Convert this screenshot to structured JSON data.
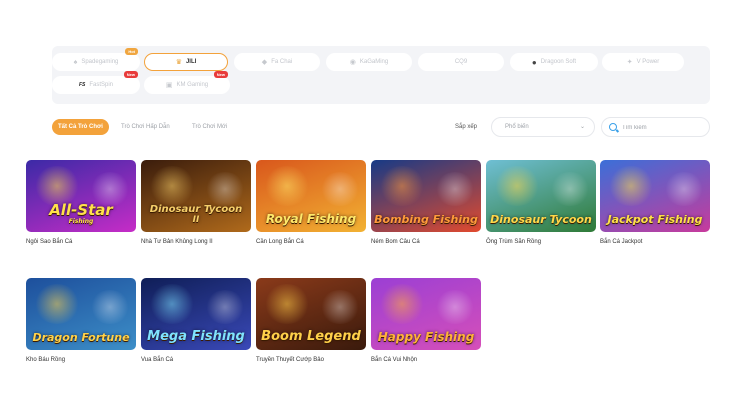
{
  "providers": [
    {
      "name": "Spadegaming",
      "badge": "Hot",
      "active": false
    },
    {
      "name": "JILI",
      "badge": "",
      "active": true
    },
    {
      "name": "Fa Chai",
      "badge": "",
      "active": false
    },
    {
      "name": "KaGaMing",
      "badge": "",
      "active": false
    },
    {
      "name": "CQ9",
      "badge": "",
      "active": false
    },
    {
      "name": "Dragoon Soft",
      "badge": "",
      "active": false
    },
    {
      "name": "V Power",
      "badge": "",
      "active": false
    },
    {
      "name": "FastSpin",
      "badge": "New",
      "active": false
    },
    {
      "name": "KM Gaming",
      "badge": "New",
      "active": false
    }
  ],
  "filters": {
    "tabs": [
      "Tất Cả Trò Chơi",
      "Trò Chơi Hấp Dẫn",
      "Trò Chơi Mới"
    ],
    "active_tab": 0,
    "sort_label": "Sắp xếp",
    "sort_value": "Phổ biến",
    "search_placeholder": "Tìm kiếm"
  },
  "games": [
    {
      "name": "Ngôi Sao Bắn Cá",
      "logo": "All-Star",
      "logo_sub": "Fishing",
      "bg_top": "#3b2aa6",
      "bg_bottom": "#c62cc7",
      "logo_color": "#ffe14a"
    },
    {
      "name": "Nhà Tư Bản Khủng Long II",
      "logo": "Dinosaur Tycoon",
      "logo_sub": "II",
      "bg_top": "#3a1c0c",
      "bg_bottom": "#b06a1b",
      "logo_color": "#f6cf6a"
    },
    {
      "name": "Cần Long Bắn Cá",
      "logo": "Royal Fishing",
      "logo_sub": "",
      "bg_top": "#d9571c",
      "bg_bottom": "#f2b233",
      "logo_color": "#ffe86a"
    },
    {
      "name": "Ném Bom Câu Cá",
      "logo": "Bombing Fishing",
      "logo_sub": "",
      "bg_top": "#173a86",
      "bg_bottom": "#e24a2e",
      "logo_color": "#ff9a3b"
    },
    {
      "name": "Ông Trùm Săn Rồng",
      "logo": "Dinosaur Tycoon",
      "logo_sub": "",
      "bg_top": "#6fbfd4",
      "bg_bottom": "#2f7a36",
      "logo_color": "#ffd84a"
    },
    {
      "name": "Bắn Cá Jackpot",
      "logo": "Jackpot Fishing",
      "logo_sub": "",
      "bg_top": "#3b6fd8",
      "bg_bottom": "#c83a9c",
      "logo_color": "#ffe04a"
    },
    {
      "name": "Kho Báu Rồng",
      "logo": "Dragon Fortune",
      "logo_sub": "",
      "bg_top": "#1d4f9c",
      "bg_bottom": "#3d8fc8",
      "logo_color": "#ffd24a"
    },
    {
      "name": "Vua Bắn Cá",
      "logo": "Mega Fishing",
      "logo_sub": "",
      "bg_top": "#0f1e57",
      "bg_bottom": "#3a49b8",
      "logo_color": "#7fe3ff"
    },
    {
      "name": "Truyền Thuyết Cướp Bảo",
      "logo": "Boom Legend",
      "logo_sub": "",
      "bg_top": "#8a3a1a",
      "bg_bottom": "#3a1a0c",
      "logo_color": "#ffd04a"
    },
    {
      "name": "Bắn Cá Vui Nhộn",
      "logo": "Happy Fishing",
      "logo_sub": "",
      "bg_top": "#9b3fd4",
      "bg_bottom": "#d64fb9",
      "logo_color": "#ffb13b"
    }
  ]
}
